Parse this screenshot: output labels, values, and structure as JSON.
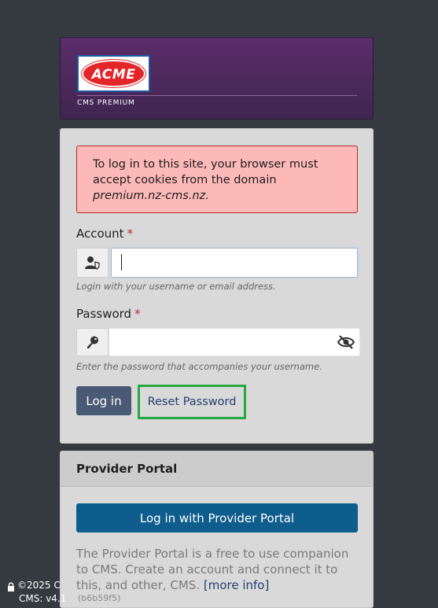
{
  "brand": {
    "logo_text": "ACME",
    "subtitle": "CMS PREMIUM"
  },
  "alert": {
    "message": "To log in to this site, your browser must accept cookies from the domain ",
    "domain": "premium.nz-cms.nz."
  },
  "account": {
    "label": "Account",
    "required": "*",
    "value": "",
    "help": "Login with your username or email address."
  },
  "password": {
    "label": "Password",
    "required": "*",
    "value": "",
    "help": "Enter the password that accompanies your username."
  },
  "actions": {
    "login_label": "Log in",
    "reset_label": "Reset Password"
  },
  "portal": {
    "title": "Provider Portal",
    "button_label": "Log in with Provider Portal",
    "description": "The Provider Portal is a free to use companion to CMS. Create an account and connect it to this, and other, CMS. ",
    "more_info": "[more info]",
    "build": "(b6b59f5)"
  },
  "footer": {
    "copyright": "©2025 C",
    "version": "CMS: v4.1"
  },
  "icons": {
    "account": "user-shield-icon",
    "password": "key-icon",
    "toggle": "eye-slash-icon",
    "footer": "lock-icon"
  },
  "colors": {
    "brand_purple": "#5b2d6a",
    "alert_bg": "#fdb8b8",
    "login_button": "#4a5a74",
    "portal_button": "#0e5d8c",
    "highlight": "#28a745"
  }
}
